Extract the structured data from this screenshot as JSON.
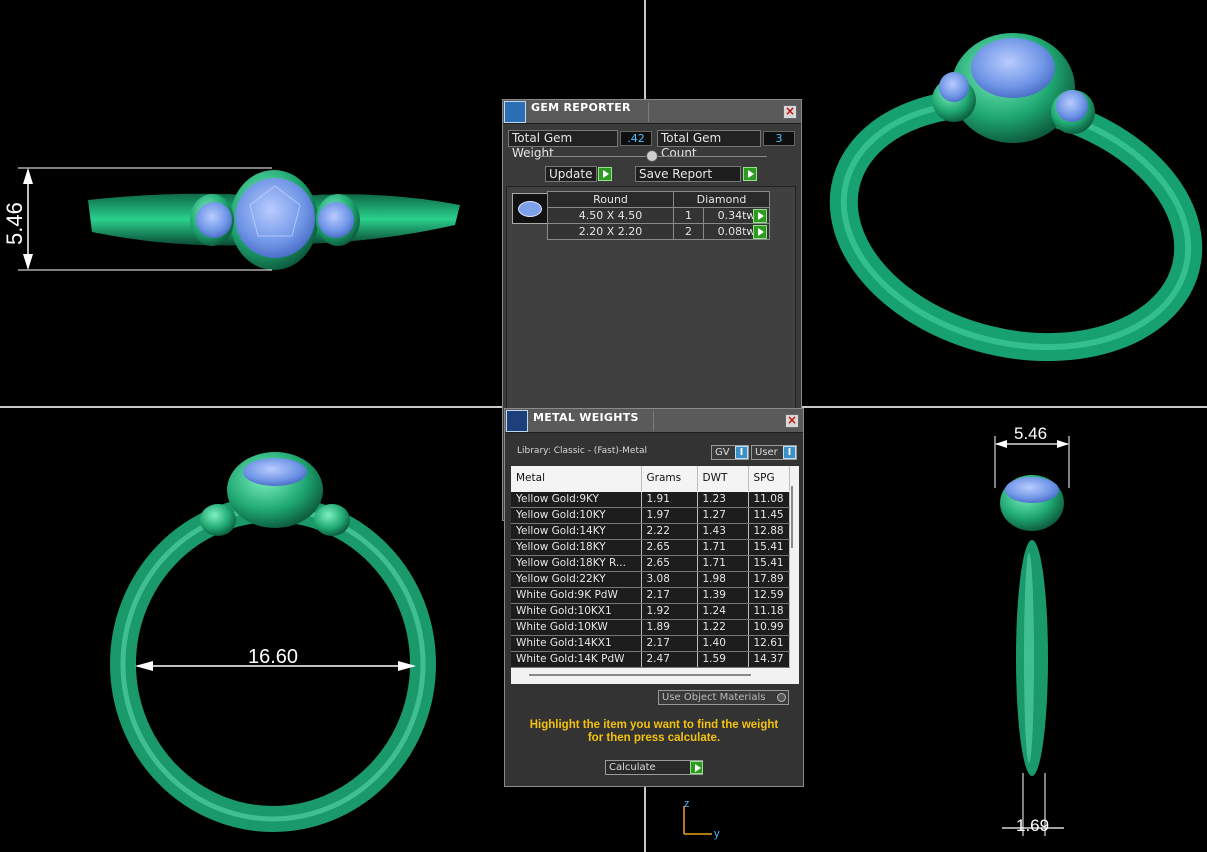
{
  "views": {
    "front_dim": "5.46",
    "ring_size_dim": "16.60",
    "side_top_dim": "5.46",
    "side_bottom_dim": "1.69",
    "axis_z": "z",
    "axis_y": "y"
  },
  "gem_reporter": {
    "title": "GEM REPORTER",
    "total_weight_label": "Total Gem Weight",
    "total_weight_value": ".42",
    "total_count_label": "Total Gem Count",
    "total_count_value": "3",
    "update_label": "Update",
    "save_report_label": "Save Report",
    "shape": "Round",
    "material": "Diamond",
    "gems": [
      {
        "size": "4.50 X 4.50",
        "count": "1",
        "weight": "0.34tw"
      },
      {
        "size": "2.20 X 2.20",
        "count": "2",
        "weight": "0.08tw"
      }
    ]
  },
  "metal_weights": {
    "title": "METAL WEIGHTS",
    "library": "Library: Classic - (Fast)-Metal",
    "gv_label": "GV",
    "user_label": "User",
    "columns": [
      "Metal",
      "Grams",
      "DWT",
      "SPG"
    ],
    "rows": [
      [
        "Yellow Gold:9KY",
        "1.91",
        "1.23",
        "11.08"
      ],
      [
        "Yellow Gold:10KY",
        "1.97",
        "1.27",
        "11.45"
      ],
      [
        "Yellow Gold:14KY",
        "2.22",
        "1.43",
        "12.88"
      ],
      [
        "Yellow Gold:18KY",
        "2.65",
        "1.71",
        "15.41"
      ],
      [
        "Yellow Gold:18KY R...",
        "2.65",
        "1.71",
        "15.41"
      ],
      [
        "Yellow Gold:22KY",
        "3.08",
        "1.98",
        "17.89"
      ],
      [
        "White Gold:9K PdW",
        "2.17",
        "1.39",
        "12.59"
      ],
      [
        "White Gold:10KX1",
        "1.92",
        "1.24",
        "11.18"
      ],
      [
        "White Gold:10KW",
        "1.89",
        "1.22",
        "10.99"
      ],
      [
        "White Gold:14KX1",
        "2.17",
        "1.40",
        "12.61"
      ],
      [
        "White Gold:14K PdW",
        "2.47",
        "1.59",
        "14.37"
      ]
    ],
    "use_object_materials": "Use Object Materials",
    "hint_line1": "Highlight the item you want to find the weight",
    "hint_line2": "for then press calculate.",
    "calculate_label": "Calculate"
  },
  "colors": {
    "background": "#000000",
    "metal_green": "#1a9a6a",
    "gem_blue": "#6f95e6",
    "hint_yellow": "#f4c20d"
  }
}
